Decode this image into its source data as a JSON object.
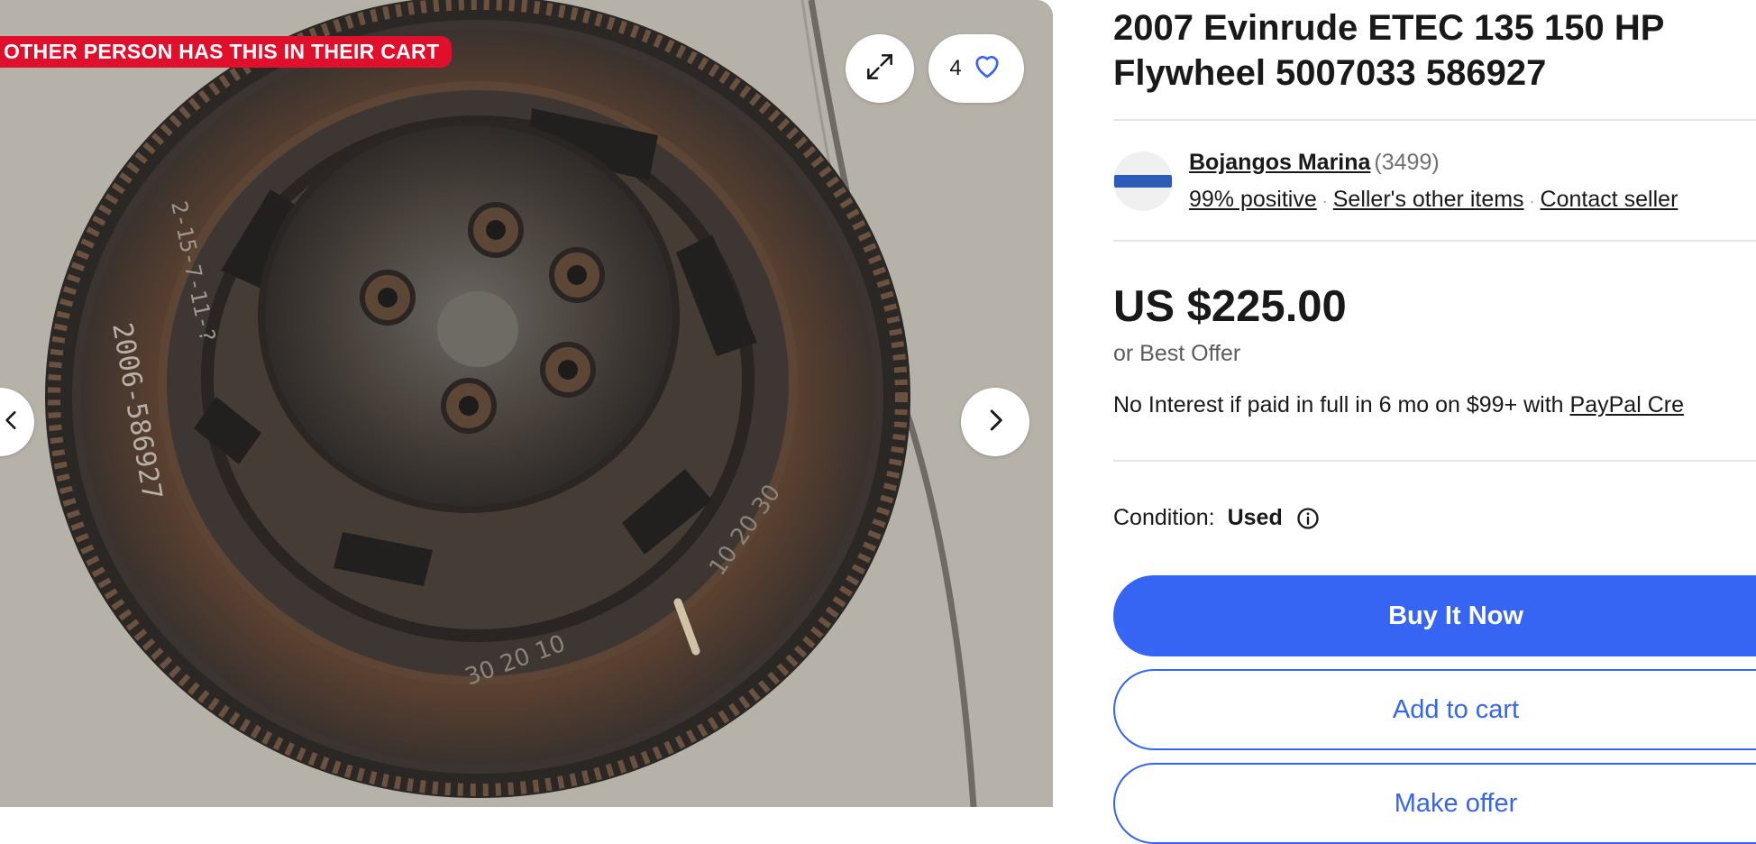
{
  "gallery": {
    "cart_banner": "OTHER PERSON HAS THIS IN THEIR CART",
    "watch_count": "4",
    "icons": {
      "expand": "expand-icon",
      "heart": "heart-icon",
      "next": "chevron-right-icon",
      "prev": "chevron-left-icon"
    },
    "photo_markings": {
      "part_number": "2006-586927",
      "stamp": "2-15-7-11-?",
      "scale_a": "30 20 10",
      "scale_b": "10 20 30"
    }
  },
  "listing": {
    "title": "2007 Evinrude ETEC 135 150 HP Flywheel 5007033 586927",
    "seller": {
      "name": "Bojangos Marina",
      "feedback_count": "(3499)",
      "positive": "99% positive",
      "other_items": "Seller's other items",
      "contact": "Contact seller",
      "separator": "·"
    },
    "price": "US $225.00",
    "best_offer": "or Best Offer",
    "financing_text": "No Interest if paid in full in 6 mo on $99+ with ",
    "financing_link": "PayPal Cre",
    "condition_label": "Condition:",
    "condition_value": "Used",
    "buttons": {
      "buy_now": "Buy It Now",
      "add_to_cart": "Add to cart",
      "make_offer": "Make offer"
    }
  },
  "colors": {
    "accent": "#3665f3",
    "banner_red": "#e0102d",
    "text": "#191919",
    "muted": "#707070"
  }
}
